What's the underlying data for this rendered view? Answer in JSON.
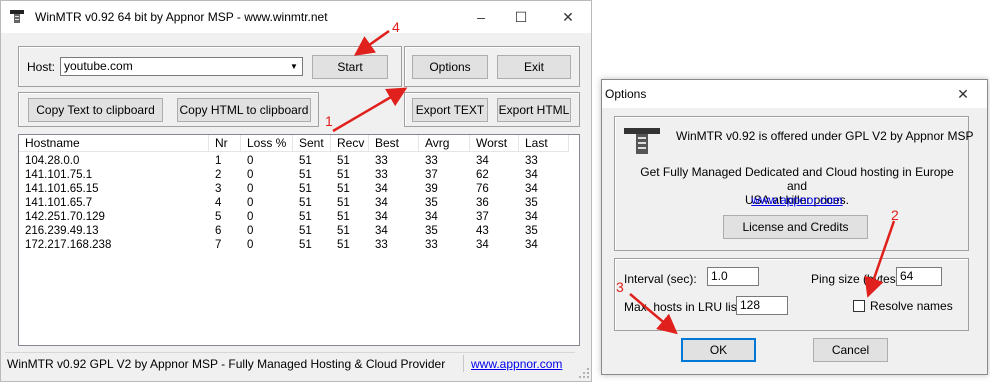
{
  "main_window": {
    "title": "WinMTR v0.92 64 bit by Appnor MSP - www.winmtr.net",
    "host_label": "Host:",
    "host_value": "youtube.com",
    "start_label": "Start",
    "options_label": "Options",
    "exit_label": "Exit",
    "copy_text_label": "Copy Text to clipboard",
    "copy_html_label": "Copy HTML to clipboard",
    "export_text_label": "Export TEXT",
    "export_html_label": "Export HTML",
    "columns": [
      "Hostname",
      "Nr",
      "Loss %",
      "Sent",
      "Recv",
      "Best",
      "Avrg",
      "Worst",
      "Last"
    ],
    "rows": [
      [
        "104.28.0.0",
        "1",
        "0",
        "51",
        "51",
        "33",
        "33",
        "34",
        "33"
      ],
      [
        "141.101.75.1",
        "2",
        "0",
        "51",
        "51",
        "33",
        "37",
        "62",
        "34"
      ],
      [
        "141.101.65.15",
        "3",
        "0",
        "51",
        "51",
        "34",
        "39",
        "76",
        "34"
      ],
      [
        "141.101.65.7",
        "4",
        "0",
        "51",
        "51",
        "34",
        "35",
        "36",
        "35"
      ],
      [
        "142.251.70.129",
        "5",
        "0",
        "51",
        "51",
        "34",
        "34",
        "37",
        "34"
      ],
      [
        "216.239.49.13",
        "6",
        "0",
        "51",
        "51",
        "34",
        "35",
        "43",
        "35"
      ],
      [
        "172.217.168.238",
        "7",
        "0",
        "51",
        "51",
        "33",
        "33",
        "34",
        "34"
      ]
    ],
    "status_text": "WinMTR v0.92 GPL V2 by Appnor MSP - Fully Managed Hosting & Cloud Provider",
    "status_link": "www.appnor.com"
  },
  "options_dialog": {
    "title": "Options",
    "about_line": "WinMTR v0.92 is offered under GPL V2 by Appnor MSP",
    "promo_line1": "Get Fully Managed Dedicated and Cloud hosting in Europe and",
    "promo_line2": "USA at killer prices.",
    "link": "www.appnor.com",
    "license_label": "License and Credits",
    "interval_label": "Interval (sec):",
    "interval_value": "1.0",
    "ping_size_label": "Ping size (bytes):",
    "ping_size_value": "64",
    "max_hosts_label": "Max. hosts in LRU list:",
    "max_hosts_value": "128",
    "resolve_label": "Resolve names",
    "resolve_checked": false,
    "ok_label": "OK",
    "cancel_label": "Cancel"
  },
  "annotations": {
    "n1": "1",
    "n2": "2",
    "n3": "3",
    "n4": "4",
    "color": "#e0201c"
  }
}
